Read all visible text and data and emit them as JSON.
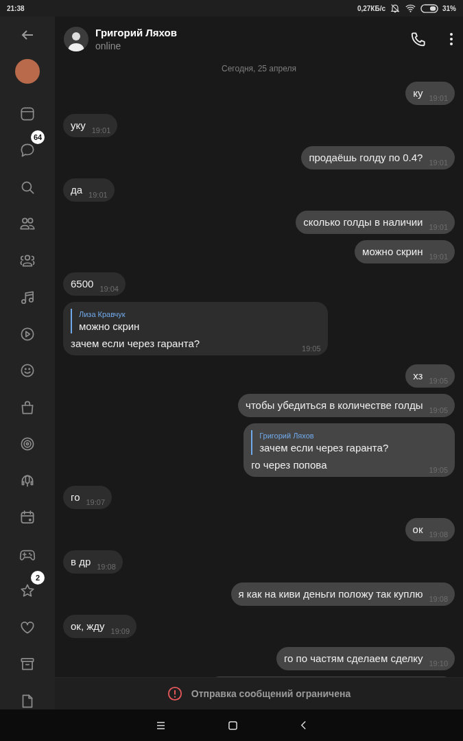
{
  "status_bar": {
    "time": "21:38",
    "speed": "0,27КБ/с",
    "battery": "31%"
  },
  "sidebar": {
    "items": [
      {
        "kind": "window"
      },
      {
        "kind": "chat",
        "badge": "64"
      },
      {
        "kind": "search"
      },
      {
        "kind": "friends"
      },
      {
        "kind": "communities"
      },
      {
        "kind": "music"
      },
      {
        "kind": "video"
      },
      {
        "kind": "smile"
      },
      {
        "kind": "bag"
      },
      {
        "kind": "target"
      },
      {
        "kind": "podcast"
      },
      {
        "kind": "calendar"
      },
      {
        "kind": "gamepad"
      },
      {
        "kind": "star",
        "badge": "2"
      },
      {
        "kind": "heart"
      },
      {
        "kind": "archive"
      },
      {
        "kind": "file"
      }
    ]
  },
  "header": {
    "name": "Григорий Ляхов",
    "status": "online"
  },
  "date": "Сегодня, 25 апреля",
  "messages": [
    {
      "outgoing": true,
      "text": "ку",
      "time": "19:01"
    },
    {
      "outgoing": false,
      "text": "уку",
      "time": "19:01"
    },
    {
      "outgoing": true,
      "text": "продаёшь голду по 0.4?",
      "time": "19:01"
    },
    {
      "outgoing": false,
      "text": "да",
      "time": "19:01"
    },
    {
      "outgoing": true,
      "text": "сколько голды в наличии",
      "time": "19:01"
    },
    {
      "outgoing": true,
      "text": "можно скрин",
      "time": "19:01"
    },
    {
      "outgoing": false,
      "text": "6500",
      "time": "19:04"
    },
    {
      "outgoing": false,
      "text": "зачем если через гаранта?",
      "time": "19:05",
      "reply": {
        "author": "Лиза Кравчук",
        "text": "можно скрин"
      }
    },
    {
      "outgoing": true,
      "text": "хз",
      "time": "19:05"
    },
    {
      "outgoing": true,
      "text": "чтобы убедиться в количестве голды",
      "time": "19:05"
    },
    {
      "outgoing": true,
      "text": "го через попова",
      "time": "19:05",
      "reply": {
        "author": "Григорий Ляхов",
        "text": "зачем если через гаранта?"
      }
    },
    {
      "outgoing": false,
      "text": "го",
      "time": "19:07"
    },
    {
      "outgoing": true,
      "text": "ок",
      "time": "19:08"
    },
    {
      "outgoing": false,
      "text": "в др",
      "time": "19:08"
    },
    {
      "outgoing": true,
      "text": "я как на киви деньги положу так куплю",
      "time": "19:08"
    },
    {
      "outgoing": false,
      "text": "ок, жду",
      "time": "19:09"
    },
    {
      "outgoing": true,
      "text": "го по частям сделаем сделку",
      "time": "19:10"
    },
    {
      "outgoing": true,
      "kind": "cut"
    }
  ],
  "footer": {
    "notice": "Отправка сообщений ограничена"
  }
}
